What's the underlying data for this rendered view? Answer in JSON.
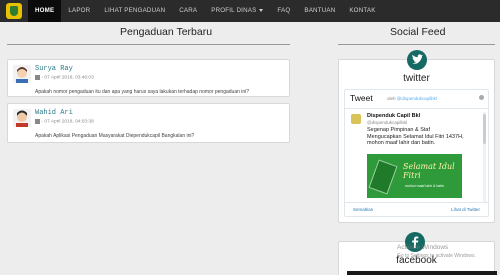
{
  "nav": {
    "items": [
      {
        "label": "HOME",
        "active": true
      },
      {
        "label": "LAPOR",
        "active": false
      },
      {
        "label": "LIHAT PENGADUAN",
        "active": false
      },
      {
        "label": "CARA",
        "active": false
      },
      {
        "label": "PROFIL DINAS",
        "active": false,
        "dropdown": true
      },
      {
        "label": "FAQ",
        "active": false
      },
      {
        "label": "BANTUAN",
        "active": false
      },
      {
        "label": "KONTAK",
        "active": false
      }
    ],
    "colors": {
      "bar": "#2b2b2b",
      "active": "#0b0b0b"
    }
  },
  "main": {
    "heading": "Pengaduan Terbaru",
    "complaints": [
      {
        "name": "Surya Ray",
        "date": "- 07 April 2018, 03:46:03",
        "question": "Apakah nomor pengaduan itu dan apa yang harus saya lakukan terhadap nomor pengaduan ini?"
      },
      {
        "name": "Wahid Ari",
        "date": "- 07 April 2018, 04:03:38",
        "question": "Apakah Aplikasi Pengaduan Masyarakat Diependukcapil Bangkalan ini?"
      }
    ]
  },
  "social": {
    "heading": "Social Feed",
    "accent_color": "#166a63",
    "twitter": {
      "icon": "twitter-icon",
      "title": "twitter",
      "widget_title": "Tweet",
      "by_prefix": "oleh",
      "by_handle": "@dispendukcapilbkl",
      "tweet": {
        "author": "Dispenduk Capil Bkl",
        "handle": "@dispendukcapilbkl",
        "text": "Segenap Pimpinan & Staf Mengucapkan Selamat Idul Fitri 1437H, mohon maaf lahir dan batin.",
        "image_title": "Selamat Idul Fitri",
        "image_subtitle": "mohon maaf lahir & batin"
      },
      "embed_link": "Sematkan",
      "view_link": "Lihat di Twitter"
    },
    "facebook": {
      "icon": "facebook-icon",
      "title": "facebook"
    }
  },
  "watermark": {
    "title": "Activate Windows",
    "subtitle": "Go to Settings to activate Windows."
  }
}
